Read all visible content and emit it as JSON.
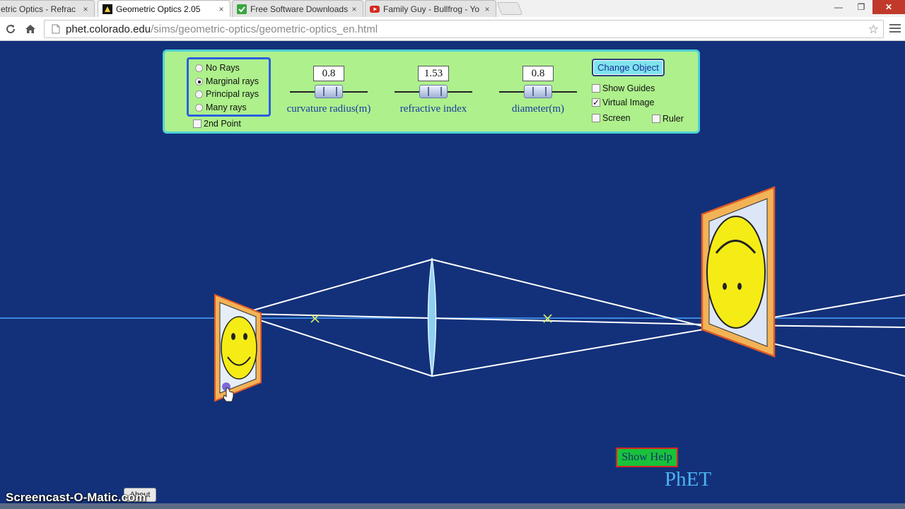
{
  "browser": {
    "tabs": [
      {
        "title": "etric Optics - Refrac",
        "active": false,
        "icon": "phet-icon"
      },
      {
        "title": "Geometric Optics 2.05",
        "active": true,
        "icon": "phet-icon"
      },
      {
        "title": "Free Software Downloads",
        "active": false,
        "icon": "download-icon"
      },
      {
        "title": "Family Guy - Bullfrog - Yo",
        "active": false,
        "icon": "youtube-icon"
      }
    ],
    "url_host": "phet.colorado.edu",
    "url_path": "/sims/geometric-optics/geometric-optics_en.html",
    "tab_close_glyph": "×",
    "window_controls": {
      "minimize": "—",
      "restore": "❐",
      "close": "✕"
    }
  },
  "sim": {
    "ray_options": [
      {
        "label": "No Rays",
        "selected": false
      },
      {
        "label": "Marginal rays",
        "selected": true
      },
      {
        "label": "Principal rays",
        "selected": false
      },
      {
        "label": "Many rays",
        "selected": false
      }
    ],
    "second_point": {
      "label": "2nd Point",
      "checked": false
    },
    "sliders": [
      {
        "value": "0.8",
        "label": "curvature radius(m)"
      },
      {
        "value": "1.53",
        "label": "refractive index"
      },
      {
        "value": "0.8",
        "label": "diameter(m)"
      }
    ],
    "change_object_label": "Change Object",
    "options": {
      "show_guides": {
        "label": "Show Guides",
        "checked": false
      },
      "virtual_image": {
        "label": "Virtual Image",
        "checked": true
      },
      "screen": {
        "label": "Screen",
        "checked": false
      },
      "ruler": {
        "label": "Ruler",
        "checked": false
      }
    },
    "show_help_label": "Show Help",
    "phet_logo": "PhET",
    "colors": {
      "background": "#13317a",
      "panel": "#aef08c",
      "ray": "#ffffff",
      "axis": "#4aa3ff",
      "focal": "#d8f060"
    }
  },
  "overlay": {
    "watermark": "Screencast-O-Matic.com",
    "about_label": "About"
  }
}
